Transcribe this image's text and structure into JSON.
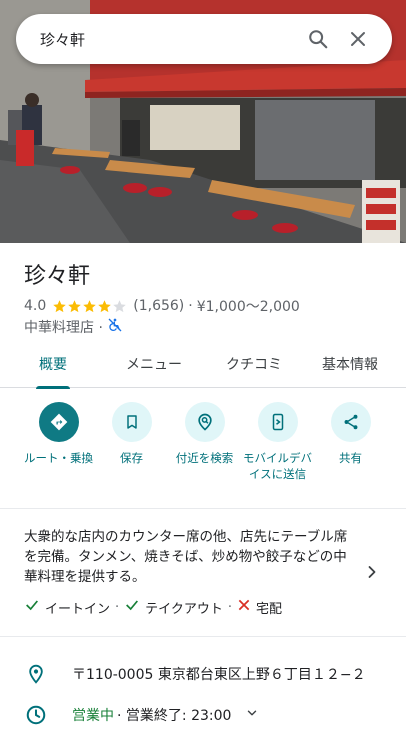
{
  "search": {
    "query": "珍々軒"
  },
  "place": {
    "name": "珍々軒",
    "rating": "4.0",
    "stars": 4,
    "review_count": "(1,656)",
    "separator": "·",
    "price_range": "¥1,000～2,000",
    "category": "中華料理店 ·",
    "accessibility_icon": "wheelchair-crossed-icon"
  },
  "tabs": [
    {
      "label": "概要",
      "active": true
    },
    {
      "label": "メニュー",
      "active": false
    },
    {
      "label": "クチコミ",
      "active": false
    },
    {
      "label": "基本情報",
      "active": false
    }
  ],
  "actions": [
    {
      "label": "ルート・乗換",
      "icon": "directions-icon"
    },
    {
      "label": "保存",
      "icon": "bookmark-icon"
    },
    {
      "label": "付近を検索",
      "icon": "nearby-search-icon"
    },
    {
      "label": "モバイルデバイスに送信",
      "icon": "send-to-device-icon"
    },
    {
      "label": "共有",
      "icon": "share-icon"
    }
  ],
  "description": "大衆的な店内のカウンター席の他、店先にテーブル席を完備。タンメン、焼きそば、炒め物や餃子などの中華料理を提供する。",
  "services": [
    {
      "label": "イートイン",
      "available": true
    },
    {
      "label": "テイクアウト",
      "available": true
    },
    {
      "label": "宅配",
      "available": false
    }
  ],
  "address": "〒110-0005 東京都台東区上野６丁目１２−２",
  "hours": {
    "status": "営業中",
    "detail": "· 営業終了: 23:00"
  },
  "colors": {
    "accent": "#00707a",
    "primary_button": "#0f7a84",
    "star": "#fbbc04",
    "open": "#188038",
    "unavailable": "#d93025"
  }
}
